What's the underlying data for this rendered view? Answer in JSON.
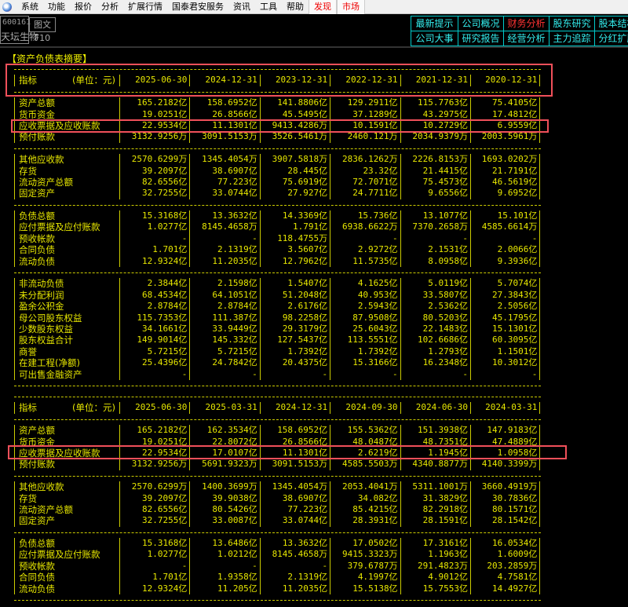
{
  "menu": [
    "系统",
    "功能",
    "报价",
    "分析",
    "扩展行情",
    "国泰君安服务",
    "资讯",
    "工具",
    "帮助"
  ],
  "menu_red": [
    "发现",
    "市场"
  ],
  "stock": {
    "code": "600161",
    "name": "天坛生物",
    "f10": "图文F10"
  },
  "tabs": [
    {
      "label": "最新提示",
      "active": false
    },
    {
      "label": "公司概况",
      "active": false
    },
    {
      "label": "财务分析",
      "active": true
    },
    {
      "label": "股东研究",
      "active": false
    },
    {
      "label": "股本结构",
      "active": false
    },
    {
      "label": "公司大事",
      "active": false
    },
    {
      "label": "研究报告",
      "active": false
    },
    {
      "label": "经营分析",
      "active": false
    },
    {
      "label": "主力追踪",
      "active": false
    },
    {
      "label": "分红扩股",
      "active": false
    }
  ],
  "title": "【资产负债表摘要】",
  "tables": [
    {
      "header_label": "指标",
      "unit": "(单位：元)",
      "columns": [
        "2025-06-30",
        "2024-12-31",
        "2023-12-31",
        "2022-12-31",
        "2021-12-31",
        "2020-12-31"
      ],
      "groups": [
        [
          [
            "资产总额",
            "165.2182亿",
            "158.6952亿",
            "141.8806亿",
            "129.2911亿",
            "115.7763亿",
            "75.4105亿"
          ],
          [
            "货币资金",
            "19.0251亿",
            "26.8566亿",
            "45.5495亿",
            "37.1289亿",
            "43.2975亿",
            "17.4812亿"
          ],
          [
            "应收票据及应收账款",
            "22.9534亿",
            "11.1301亿",
            "9413.4286万",
            "10.1591亿",
            "10.2729亿",
            "6.9559亿"
          ],
          [
            "预付账款",
            "3132.9256万",
            "3091.5153万",
            "3526.5461万",
            "2460.121万",
            "2034.9379万",
            "2003.5961万"
          ]
        ],
        [
          [
            "其他应收款",
            "2570.6299万",
            "1345.4054万",
            "3907.5818万",
            "2836.1262万",
            "2226.8153万",
            "1693.0202万"
          ],
          [
            "存货",
            "39.2097亿",
            "38.6907亿",
            "28.445亿",
            "23.32亿",
            "21.4415亿",
            "21.7191亿"
          ],
          [
            "流动资产总额",
            "82.6556亿",
            "77.223亿",
            "75.6919亿",
            "72.7071亿",
            "75.4573亿",
            "46.5619亿"
          ],
          [
            "固定资产",
            "32.7255亿",
            "33.0744亿",
            "27.927亿",
            "24.7711亿",
            "9.6556亿",
            "9.6952亿"
          ]
        ],
        [
          [
            "负债总额",
            "15.3168亿",
            "13.3632亿",
            "14.3369亿",
            "15.736亿",
            "13.1077亿",
            "15.101亿"
          ],
          [
            "应付票据及应付账款",
            "1.0277亿",
            "8145.4658万",
            "1.791亿",
            "6938.6622万",
            "7370.2658万",
            "4585.6614万"
          ],
          [
            "预收帐款",
            "-",
            "-",
            "118.4755万",
            "-",
            "-",
            "-"
          ],
          [
            "合同负债",
            "1.701亿",
            "2.1319亿",
            "3.5607亿",
            "2.9272亿",
            "2.1531亿",
            "2.0066亿"
          ],
          [
            "流动负债",
            "12.9324亿",
            "11.2035亿",
            "12.7962亿",
            "11.5735亿",
            "8.0958亿",
            "9.3936亿"
          ]
        ],
        [
          [
            "非流动负债",
            "2.3844亿",
            "2.1598亿",
            "1.5407亿",
            "4.1625亿",
            "5.0119亿",
            "5.7074亿"
          ],
          [
            "未分配利润",
            "68.4534亿",
            "64.1051亿",
            "51.2048亿",
            "40.953亿",
            "33.5807亿",
            "27.3843亿"
          ],
          [
            "盈余公积金",
            "2.8784亿",
            "2.8784亿",
            "2.6176亿",
            "2.5943亿",
            "2.5362亿",
            "2.5056亿"
          ],
          [
            "母公司股东权益",
            "115.7353亿",
            "111.387亿",
            "98.2258亿",
            "87.9508亿",
            "80.5203亿",
            "45.1795亿"
          ],
          [
            "少数股东权益",
            "34.1661亿",
            "33.9449亿",
            "29.3179亿",
            "25.6043亿",
            "22.1483亿",
            "15.1301亿"
          ],
          [
            "股东权益合计",
            "149.9014亿",
            "145.332亿",
            "127.5437亿",
            "113.5551亿",
            "102.6686亿",
            "60.3095亿"
          ],
          [
            "商誉",
            "5.7215亿",
            "5.7215亿",
            "1.7392亿",
            "1.7392亿",
            "1.2793亿",
            "1.1501亿"
          ],
          [
            "在建工程(净额)",
            "25.4396亿",
            "24.7842亿",
            "20.4375亿",
            "15.3166亿",
            "16.2348亿",
            "10.3012亿"
          ],
          [
            "可出售金融资产",
            "-",
            "-",
            "-",
            "-",
            "-",
            "-"
          ]
        ]
      ]
    },
    {
      "header_label": "指标",
      "unit": "(单位：元)",
      "columns": [
        "2025-06-30",
        "2025-03-31",
        "2024-12-31",
        "2024-09-30",
        "2024-06-30",
        "2024-03-31"
      ],
      "groups": [
        [
          [
            "资产总额",
            "165.2182亿",
            "162.3534亿",
            "158.6952亿",
            "155.5362亿",
            "151.3938亿",
            "147.9183亿"
          ],
          [
            "货币资金",
            "19.0251亿",
            "22.8072亿",
            "26.8566亿",
            "48.0487亿",
            "48.7351亿",
            "47.4889亿"
          ],
          [
            "应收票据及应收账款",
            "22.9534亿",
            "17.0107亿",
            "11.1301亿",
            "2.6219亿",
            "1.1945亿",
            "1.0958亿"
          ],
          [
            "预付账款",
            "3132.9256万",
            "5691.9323万",
            "3091.5153万",
            "4585.5503万",
            "4340.8877万",
            "4140.3399万"
          ]
        ],
        [
          [
            "其他应收款",
            "2570.6299万",
            "1400.3699万",
            "1345.4054万",
            "2053.4041万",
            "5311.1001万",
            "3660.4919万"
          ],
          [
            "存货",
            "39.2097亿",
            "39.9038亿",
            "38.6907亿",
            "34.082亿",
            "31.3829亿",
            "30.7836亿"
          ],
          [
            "流动资产总额",
            "82.6556亿",
            "80.5426亿",
            "77.223亿",
            "85.4215亿",
            "82.2918亿",
            "80.1571亿"
          ],
          [
            "固定资产",
            "32.7255亿",
            "33.0087亿",
            "33.0744亿",
            "28.3931亿",
            "28.1591亿",
            "28.1542亿"
          ]
        ],
        [
          [
            "负债总额",
            "15.3168亿",
            "13.6486亿",
            "13.3632亿",
            "17.0502亿",
            "17.3161亿",
            "16.0534亿"
          ],
          [
            "应付票据及应付账款",
            "1.0277亿",
            "1.0212亿",
            "8145.4658万",
            "9415.3323万",
            "1.1963亿",
            "1.6009亿"
          ],
          [
            "预收帐款",
            "-",
            "-",
            "-",
            "379.6787万",
            "291.4823万",
            "203.2859万"
          ],
          [
            "合同负债",
            "1.701亿",
            "1.9358亿",
            "2.1319亿",
            "4.1997亿",
            "4.9012亿",
            "4.7581亿"
          ],
          [
            "流动负债",
            "12.9324亿",
            "11.205亿",
            "11.2035亿",
            "15.5138亿",
            "15.7553亿",
            "14.4927亿"
          ]
        ]
      ]
    }
  ],
  "colors": {
    "text": "#e6e600",
    "highlight": "#f0505a",
    "tab": "#33eeee"
  }
}
